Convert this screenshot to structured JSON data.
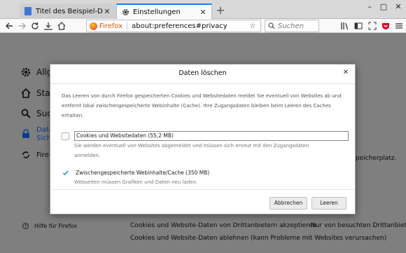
{
  "tabs": [
    {
      "title": "Titel des Beispiel-Dokuments",
      "active": false
    },
    {
      "title": "Einstellungen",
      "active": true
    }
  ],
  "window_controls": {
    "minimize": "–",
    "maximize": "□",
    "close": "✕"
  },
  "navigation": {
    "identity_label": "Firefox",
    "url": "about:preferences#privacy",
    "search_placeholder": "Suchen"
  },
  "toolbar_icons": [
    "library-icon",
    "sidebar-icon",
    "screenshot-icon",
    "pocket-icon",
    "shield-icon",
    "menu-icon"
  ],
  "sidebar": {
    "items": [
      {
        "label": "Allge",
        "icon": "gear-icon"
      },
      {
        "label": "Start",
        "icon": "home-icon"
      },
      {
        "label": "Such",
        "icon": "search-icon"
      },
      {
        "label": "Date",
        "label2": "Sich",
        "icon": "lock-icon",
        "selected": true
      },
      {
        "label": "Firefo",
        "icon": "sync-icon"
      }
    ],
    "help": "Hilfe für Firefox"
  },
  "background_text": {
    "right_fragment": "peicherplatz.",
    "row1_left": "Cookies und Website-Daten von Drittanbietern akzeptieren",
    "row1_right": "Nur von besuchten Drittanbiet",
    "row2": "Cookies und Website-Daten ablehnen (kann Probleme mit Websites verursachen)"
  },
  "dialog": {
    "title": "Daten löschen",
    "description": "Das Leeren von durch Firefox gespeicherten Cookies und Websitedaten meldet Sie eventuell von Websites ab und entfernt lokal zwischengespeicherte Webinhalte (Cache). Ihre Zugangsdaten bleiben beim Leeren des Caches erhalten.",
    "options": [
      {
        "label": "Cookies und Websitedaten (55,2 MB)",
        "checked": false,
        "note": "Sie werden eventuell von Websites abgemeldet und müssen sich erneut mit den Zugangsdaten anmelden."
      },
      {
        "label": "Zwischengespeicherte Webinhalte/Cache (350 MB)",
        "checked": true,
        "note": "Webseiten müssen Grafiken und Daten neu laden."
      }
    ],
    "buttons": {
      "cancel": "Abbrechen",
      "clear": "Leeren"
    }
  },
  "colors": {
    "accent": "#0a84ff",
    "overlay": "#7f7f7f"
  }
}
